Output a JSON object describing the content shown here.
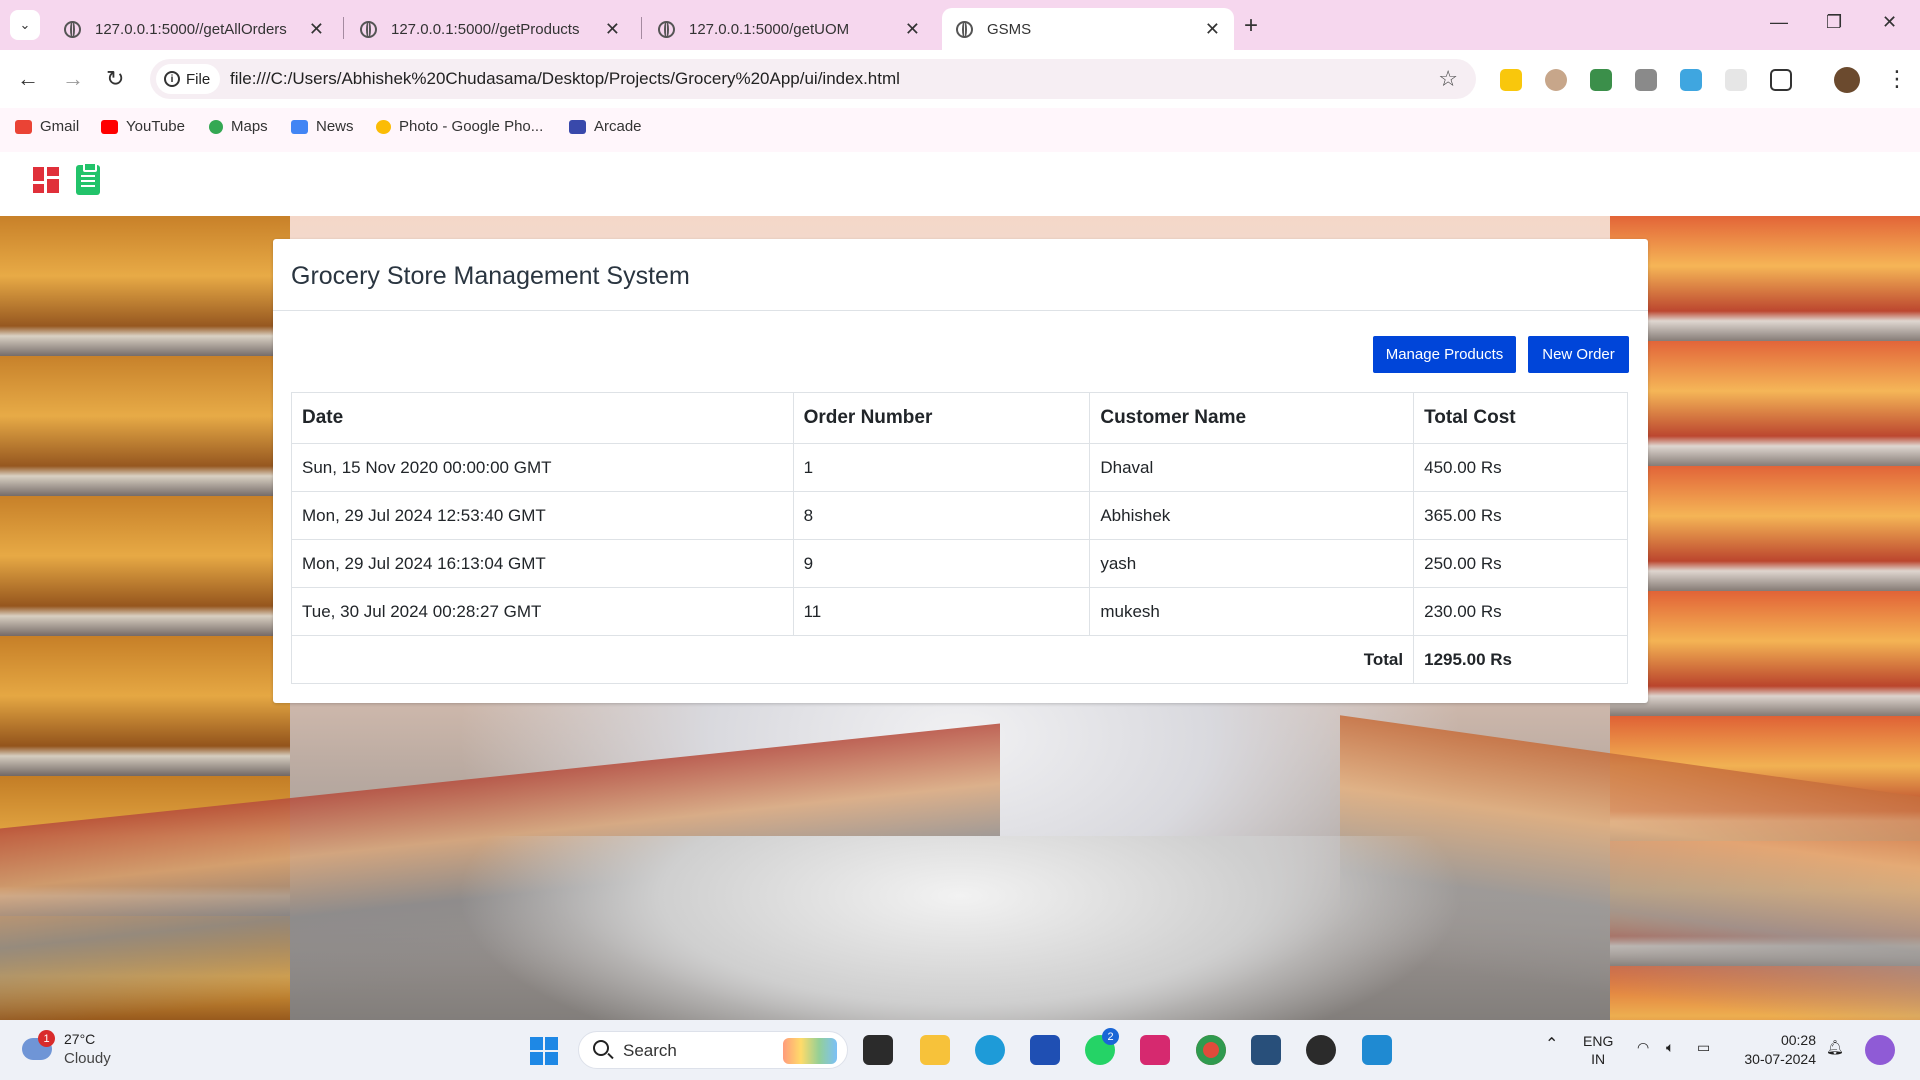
{
  "browser": {
    "tabs": [
      {
        "label": "127.0.0.1:5000//getAllOrders"
      },
      {
        "label": "127.0.0.1:5000//getProducts"
      },
      {
        "label": "127.0.0.1:5000/getUOM"
      },
      {
        "label": "GSMS"
      }
    ],
    "chip_label": "File",
    "url": "file:///C:/Users/Abhishek%20Chudasama/Desktop/Projects/Grocery%20App/ui/index.html",
    "bookmarks": [
      {
        "label": "Gmail",
        "color": "#ea4335"
      },
      {
        "label": "YouTube",
        "color": "#ff0000"
      },
      {
        "label": "Maps",
        "color": "#34a853"
      },
      {
        "label": "News",
        "color": "#4285f4"
      },
      {
        "label": "Photo - Google Pho...",
        "color": "#fbbc05"
      },
      {
        "label": "Arcade",
        "color": "#3949ab"
      }
    ]
  },
  "app": {
    "title": "Grocery Store Management System",
    "buttons": {
      "manage_products": "Manage Products",
      "new_order": "New Order"
    },
    "table": {
      "headers": [
        "Date",
        "Order Number",
        "Customer Name",
        "Total Cost"
      ],
      "rows": [
        {
          "date": "Sun, 15 Nov 2020 00:00:00 GMT",
          "order_number": "1",
          "customer": "Dhaval",
          "total": "450.00 Rs"
        },
        {
          "date": "Mon, 29 Jul 2024 12:53:40 GMT",
          "order_number": "8",
          "customer": "Abhishek",
          "total": "365.00 Rs"
        },
        {
          "date": "Mon, 29 Jul 2024 16:13:04 GMT",
          "order_number": "9",
          "customer": "yash",
          "total": "250.00 Rs"
        },
        {
          "date": "Tue, 30 Jul 2024 00:28:27 GMT",
          "order_number": "11",
          "customer": "mukesh",
          "total": "230.00 Rs"
        }
      ],
      "total_label": "Total",
      "total_value": "1295.00 Rs"
    },
    "colors": {
      "primary_button": "#0045d9",
      "logo_red": "#e0303a",
      "logo_green": "#22c36a"
    }
  },
  "taskbar": {
    "weather": {
      "temp": "27°C",
      "condition": "Cloudy",
      "badge": "1"
    },
    "search_label": "Search",
    "whatsapp_badge": "2",
    "language": {
      "line1": "ENG",
      "line2": "IN"
    },
    "clock": {
      "time": "00:28",
      "date": "30-07-2024"
    }
  }
}
